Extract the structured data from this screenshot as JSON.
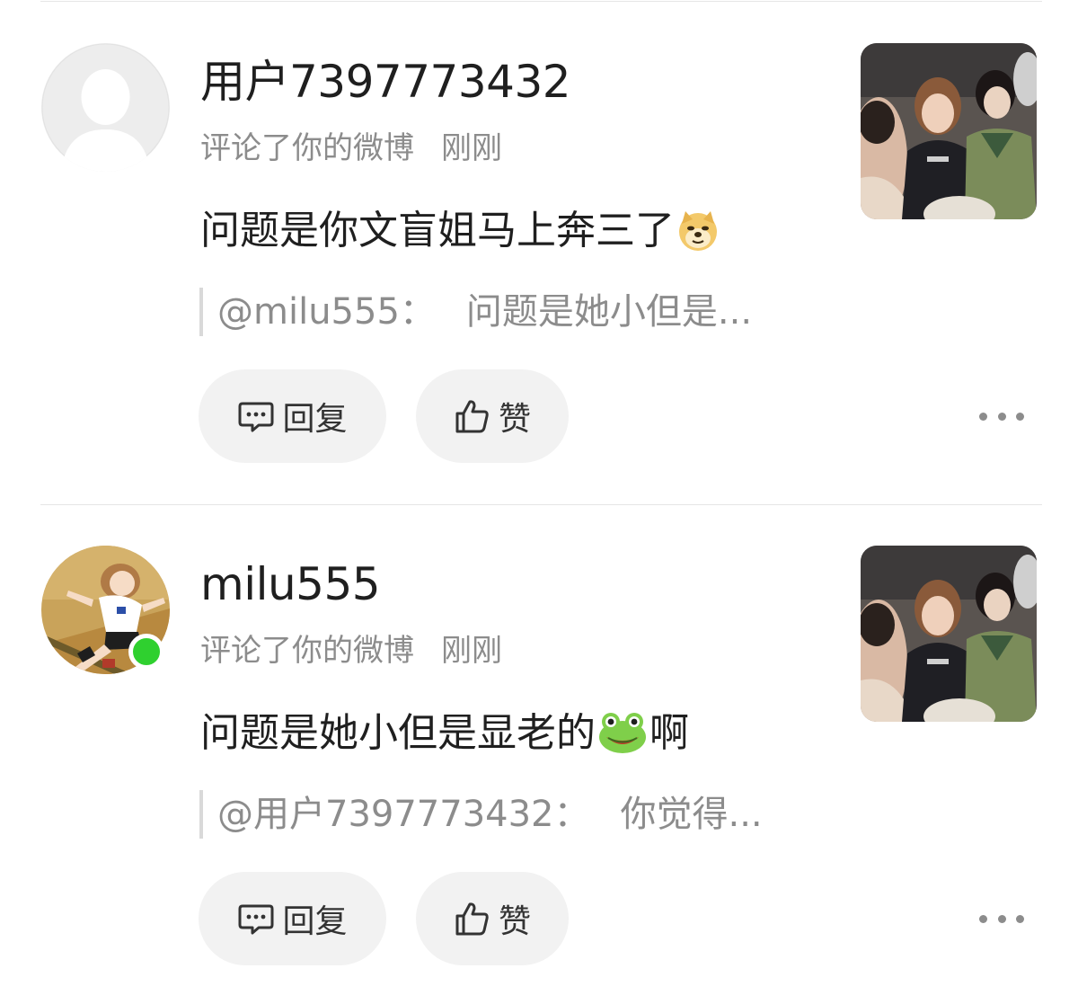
{
  "comments": [
    {
      "username": "用户7397773432",
      "action": "评论了你的微博",
      "time": "刚刚",
      "content_text": "问题是你文盲姐马上奔三了",
      "content_emoji": "doge-emoji",
      "quote_mention": "@milu555：",
      "quote_text": "问题是她小但是...",
      "reply_label": "回复",
      "like_label": "赞",
      "avatar": "default-avatar",
      "online": false
    },
    {
      "username": "milu555",
      "action": "评论了你的微博",
      "time": "刚刚",
      "content_before": "问题是她小但是显老的",
      "content_emoji": "frog-emoji",
      "content_after": "啊",
      "quote_mention": "@用户7397773432：",
      "quote_text": "你觉得...",
      "reply_label": "回复",
      "like_label": "赞",
      "avatar": "anime-girl-avatar",
      "online": true
    }
  ],
  "icons": {
    "reply": "comment-bubble-icon",
    "like": "thumbs-up-icon",
    "more": "more-dots-icon"
  },
  "colors": {
    "online": "#2fd02f",
    "secondary_text": "#8c8c8c",
    "button_bg": "#f2f2f2"
  }
}
